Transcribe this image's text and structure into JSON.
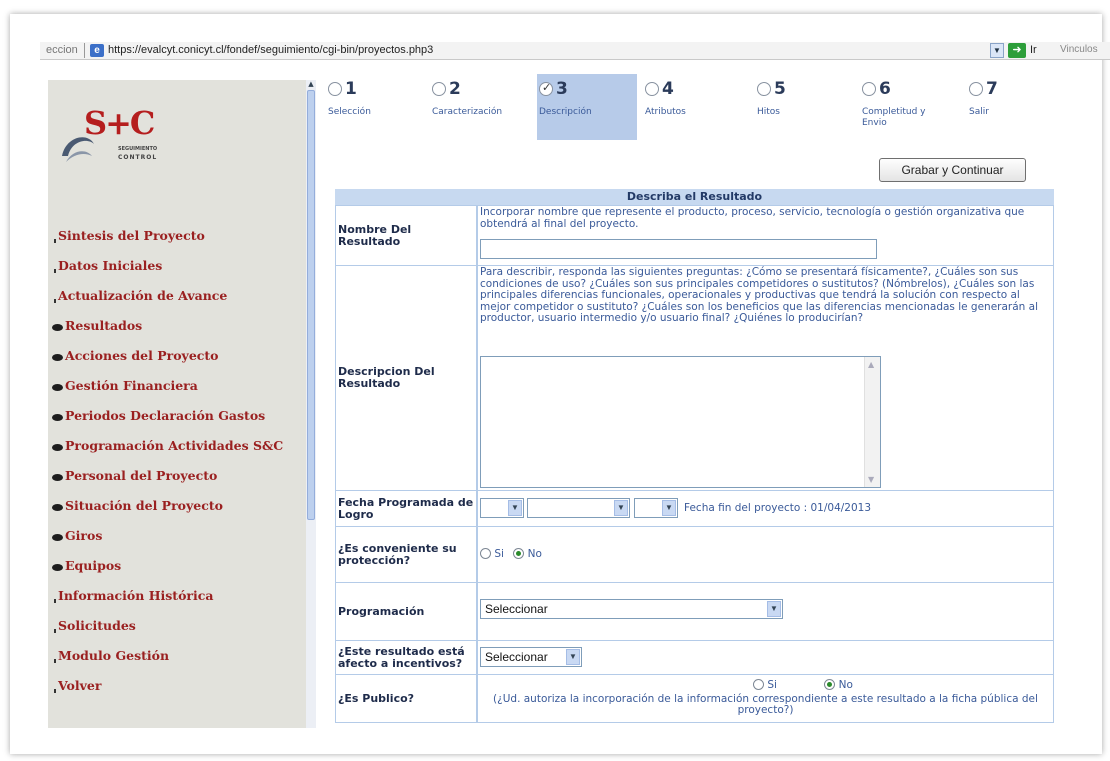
{
  "browser": {
    "address_lead": "eccion",
    "url": "https://evalcyt.conicyt.cl/fondef/seguimiento/cgi-bin/proyectos.php3",
    "go_label": "Ir",
    "links_label": "Vinculos"
  },
  "logo": {
    "brand": "S+C",
    "sub1": "SEGUIMIENTO",
    "sub2": "CONTROL"
  },
  "nav": [
    {
      "label": "Sintesis del Proyecto",
      "level": 0
    },
    {
      "label": "Datos Iniciales",
      "level": 0
    },
    {
      "label": "Actualización de Avance",
      "level": 0
    },
    {
      "label": "Resultados",
      "level": 1
    },
    {
      "label": "Acciones del Proyecto",
      "level": 1
    },
    {
      "label": "Gestión Financiera",
      "level": 1
    },
    {
      "label": "Periodos Declaración Gastos",
      "level": 1
    },
    {
      "label": "Programación Actividades S&C",
      "level": 1
    },
    {
      "label": "Personal del Proyecto",
      "level": 1
    },
    {
      "label": "Situación del Proyecto",
      "level": 1
    },
    {
      "label": "Giros",
      "level": 1
    },
    {
      "label": "Equipos",
      "level": 1
    },
    {
      "label": "Información Histórica",
      "level": 0
    },
    {
      "label": "Solicitudes",
      "level": 0
    },
    {
      "label": "Modulo Gestión",
      "level": 0
    },
    {
      "label": "Volver",
      "level": 0
    }
  ],
  "steps": [
    {
      "num": "1",
      "label": "Selección",
      "checked": false,
      "active": false
    },
    {
      "num": "2",
      "label": "Caracterización",
      "checked": false,
      "active": false
    },
    {
      "num": "3",
      "label": "Descripción",
      "checked": true,
      "active": true
    },
    {
      "num": "4",
      "label": "Atributos",
      "checked": false,
      "active": false
    },
    {
      "num": "5",
      "label": "Hitos",
      "checked": false,
      "active": false
    },
    {
      "num": "6",
      "label": "Completitud y Envio",
      "checked": false,
      "active": false
    },
    {
      "num": "7",
      "label": "Salir",
      "checked": false,
      "active": false
    }
  ],
  "save_button": "Grabar y Continuar",
  "form": {
    "title": "Describa el Resultado",
    "nombre": {
      "label": "Nombre Del Resultado",
      "help": "Incorporar nombre que represente el producto, proceso, servicio, tecnología o gestión organizativa que obtendrá al final del proyecto.",
      "value": ""
    },
    "descripcion": {
      "label": "Descripcion Del Resultado",
      "help": "Para describir, responda las siguientes preguntas: ¿Cómo se presentará físicamente?, ¿Cuáles son sus condiciones de uso? ¿Cuáles son sus principales competidores o sustitutos? (Nómbrelos), ¿Cuáles son las principales diferencias funcionales, operacionales y productivas que tendrá la solución con respecto al mejor competidor o sustituto? ¿Cuáles son los beneficios que las diferencias mencionadas le generarán al productor, usuario intermedio y/o usuario final? ¿Quiénes lo producirían?",
      "value": ""
    },
    "fecha": {
      "label": "Fecha Programada de Logro",
      "day": "",
      "month": "",
      "year": "",
      "note": "Fecha fin del proyecto : 01/04/2013"
    },
    "proteccion": {
      "label": "¿Es conveniente su protección?",
      "opt_si": "Si",
      "opt_no": "No",
      "selected": "No"
    },
    "programacion": {
      "label": "Programación",
      "value": "Seleccionar"
    },
    "incentivos": {
      "label": "¿Este resultado está afecto a incentivos?",
      "value": "Seleccionar"
    },
    "publico": {
      "label": "¿Es Publico?",
      "opt_si": "Si",
      "opt_no": "No",
      "selected": "No",
      "note": "(¿Ud. autoriza la incorporación de la información correspondiente a este resultado a la ficha pública del proyecto?)"
    }
  }
}
